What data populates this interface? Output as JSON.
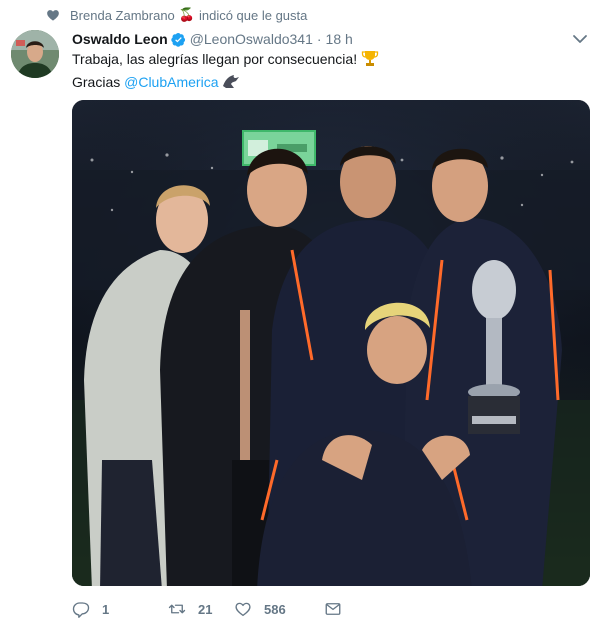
{
  "social_context": {
    "user": "Brenda Zambrano",
    "emoji": "🍒",
    "action": "indicó que le gusta"
  },
  "author": {
    "name": "Oswaldo Leon",
    "handle": "@LeonOswaldo341",
    "separator": "·",
    "time": "18 h",
    "verified": true
  },
  "tweet": {
    "line1": "Trabaja, las alegrías llegan por consecuencia!",
    "line1_emoji": "🏆",
    "line2_prefix": "Gracias",
    "mention": "@ClubAmerica",
    "line2_emoji": "🦅"
  },
  "actions": {
    "replies": "1",
    "retweets": "21",
    "likes": "586"
  },
  "colors": {
    "link": "#1da1f2",
    "muted": "#657786",
    "text": "#14171a",
    "verified": "#1da1f2"
  },
  "icons": [
    "heart-icon",
    "verified-badge-icon",
    "caret-down-icon",
    "reply-icon",
    "retweet-icon",
    "like-icon",
    "message-icon"
  ]
}
